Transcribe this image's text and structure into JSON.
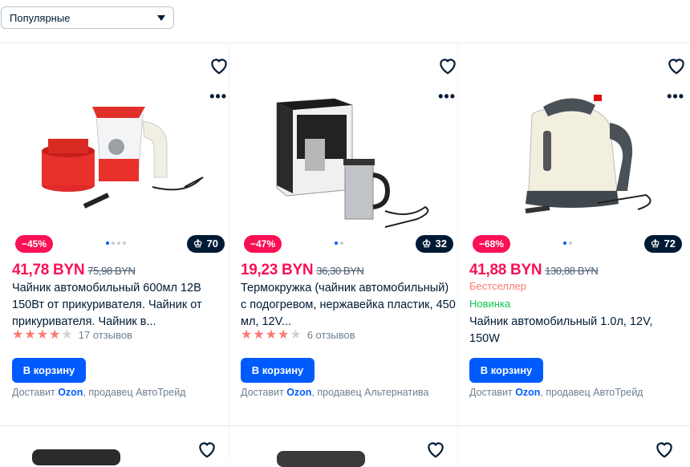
{
  "sort": {
    "label": "Популярные"
  },
  "products": [
    {
      "discount": "−45%",
      "rating_badge": "70",
      "price": "41,78 BYN",
      "old_price": "75,98 BYN",
      "title": "Чайник автомобильный 600мл 12В 150Вт от прикуривателя. Чайник от прикуривателя. Чайник в...",
      "stars_filled": 4,
      "reviews": "17 отзывов",
      "button": "В корзину",
      "delivery_prefix": "Доставит",
      "delivery_carrier": "Ozon",
      "seller": ", продавец АвтоТрейд"
    },
    {
      "discount": "−47%",
      "rating_badge": "32",
      "price": "19,23 BYN",
      "old_price": "36,30 BYN",
      "title": "Термокружка (чайник автомобильный) с подогревом, нержавейка пластик, 450 мл, 12V...",
      "stars_filled": 4,
      "reviews": "6 отзывов",
      "button": "В корзину",
      "delivery_prefix": "Доставит",
      "delivery_carrier": "Ozon",
      "seller": ", продавец Альтернатива"
    },
    {
      "discount": "−68%",
      "rating_badge": "72",
      "price": "41,88 BYN",
      "old_price": "130,88 BYN",
      "bestseller": "Бестселлер",
      "new_label": "Новинка",
      "title": "Чайник автомобильный 1.0л, 12V, 150W",
      "button": "В корзину",
      "delivery_prefix": "Доставит",
      "delivery_carrier": "Ozon",
      "seller": ", продавец АвтоТрейд"
    }
  ],
  "colors": {
    "accent": "#005bff",
    "sale": "#f91155",
    "dark": "#001a34"
  }
}
